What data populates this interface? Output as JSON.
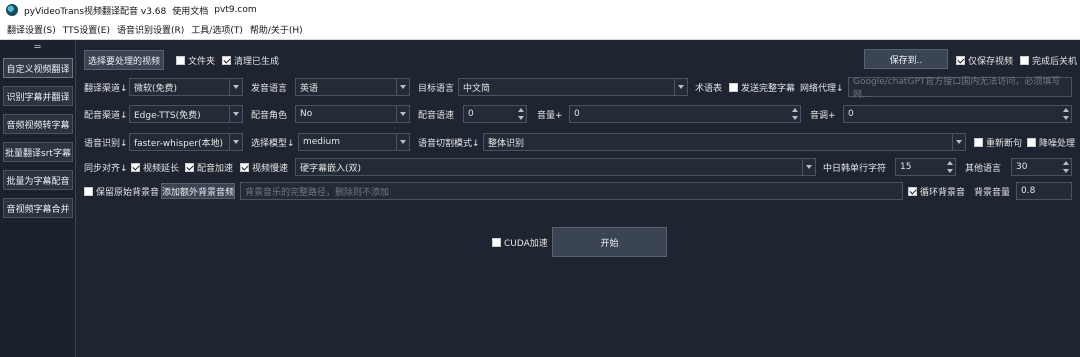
{
  "window": {
    "title": "pyVideoTrans视频翻译配音 v3.68",
    "doc_link": "使用文档",
    "site": "pvt9.com"
  },
  "menu": [
    "翻译设置(S)",
    "TTS设置(E)",
    "语音识别设置(R)",
    "工具/选项(T)",
    "帮助/关于(H)"
  ],
  "sidebar": {
    "handle": "═",
    "items": [
      "自定义视频翻译",
      "识别字幕并翻译",
      "音频视频转字幕",
      "批量翻译srt字幕",
      "批量为字幕配音",
      "音视频字幕合并"
    ]
  },
  "row1": {
    "select_button": "选择要处理的视频",
    "folder": "文件夹",
    "clear_generated": "清理已生成",
    "save_to": "保存到..",
    "only_save_video": "仅保存视频",
    "shutdown": "完成后关机"
  },
  "row2": {
    "translate_channel_label": "翻译渠道↓",
    "translate_channel": "微软(免费)",
    "source_lang_label": "发音语言",
    "source_lang": "英语",
    "target_lang_label": "目标语言",
    "target_lang": "中文简",
    "glossary": "术语表",
    "send_full_subtitle": "发送完整字幕",
    "proxy_label": "网络代理↓",
    "proxy_placeholder": "Google/chatGPT官方接口国内无法访问，必须填写网..."
  },
  "row3": {
    "dubbing_channel_label": "配音渠道↓",
    "dubbing_channel": "Edge-TTS(免费)",
    "voice_role_label": "配音角色",
    "voice_role": "No",
    "speech_rate_label": "配音语速",
    "speech_rate": "0",
    "volume_label": "音量+",
    "volume": "0",
    "pitch_label": "音调+",
    "pitch": "0"
  },
  "row4": {
    "asr_label": "语音识别↓",
    "asr": "faster-whisper(本地)",
    "model_label": "选择模型↓",
    "model": "medium",
    "split_mode_label": "语音切割模式↓",
    "split_mode": "整体识别",
    "re_segment": "重新断句",
    "denoise": "降噪处理"
  },
  "row5": {
    "sync_label": "同步对齐↓",
    "video_extend": "视频延长",
    "audio_speedup": "配音加速",
    "video_slowdown": "视频慢速",
    "subtitle_mode": "硬字幕嵌入(双)",
    "cjk_chars_label": "中日韩单行字符",
    "cjk_chars": "15",
    "other_lang_label": "其他语言",
    "other_lang": "30"
  },
  "row6": {
    "keep_bg": "保留原始背景音",
    "add_bg_button": "添加额外背景音频",
    "bg_placeholder": "背景音乐的完整路径，删除则不添加",
    "loop_bg": "循环背景音",
    "bg_volume_label": "背景音量",
    "bg_volume": "0.8"
  },
  "bottom": {
    "cuda": "CUDA加速",
    "start": "开始"
  }
}
